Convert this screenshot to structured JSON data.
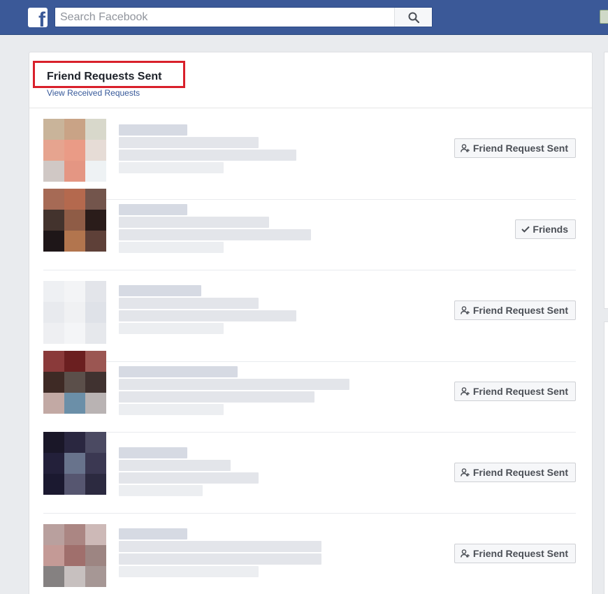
{
  "header": {
    "logo_letter": "f",
    "search_placeholder": "Search Facebook",
    "search_icon": "search-icon"
  },
  "panel": {
    "title": "Friend Requests Sent",
    "subtitle_link": "View Received Requests"
  },
  "requests": [
    {
      "button_label": "Friend Request Sent",
      "button_icon": "add-friend-icon"
    },
    {
      "button_label": "Friends",
      "button_icon": "checkmark-icon"
    },
    {
      "button_label": "Friend Request Sent",
      "button_icon": "add-friend-icon"
    },
    {
      "button_label": "Friend Request Sent",
      "button_icon": "add-friend-icon"
    },
    {
      "button_label": "Friend Request Sent",
      "button_icon": "add-friend-icon"
    },
    {
      "button_label": "Friend Request Sent",
      "button_icon": "add-friend-icon"
    }
  ],
  "colors": {
    "brand_blue": "#3b5998",
    "link_blue": "#365899",
    "highlight_red": "#d9202b",
    "page_bg": "#e9ebee"
  }
}
